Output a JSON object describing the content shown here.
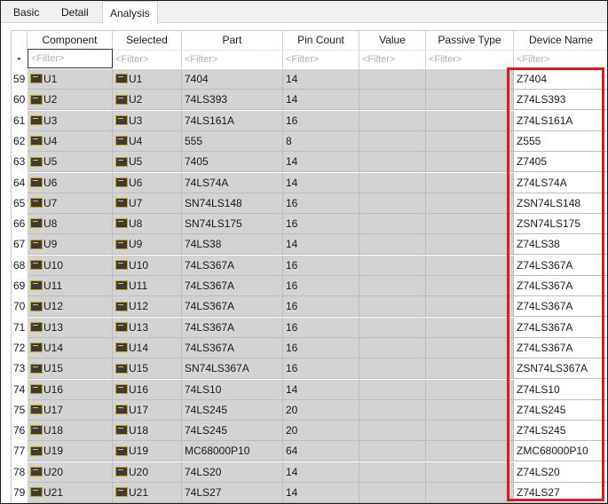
{
  "tabs": [
    "Basic",
    "Detail",
    "Analysis"
  ],
  "active_tab": "Analysis",
  "columns": [
    "Component",
    "Selected",
    "Part",
    "Pin Count",
    "Value",
    "Passive Type",
    "Device Name"
  ],
  "filter_placeholder": "<Filter>",
  "row_indicator": "▸",
  "rows": [
    {
      "num": "59",
      "component": "U1",
      "selected": "U1",
      "part": "7404",
      "pins": "14",
      "value": "",
      "passive": "",
      "device": "Z7404"
    },
    {
      "num": "60",
      "component": "U2",
      "selected": "U2",
      "part": "74LS393",
      "pins": "14",
      "value": "",
      "passive": "",
      "device": "Z74LS393"
    },
    {
      "num": "61",
      "component": "U3",
      "selected": "U3",
      "part": "74LS161A",
      "pins": "16",
      "value": "",
      "passive": "",
      "device": "Z74LS161A"
    },
    {
      "num": "62",
      "component": "U4",
      "selected": "U4",
      "part": "555",
      "pins": "8",
      "value": "",
      "passive": "",
      "device": "Z555"
    },
    {
      "num": "63",
      "component": "U5",
      "selected": "U5",
      "part": "7405",
      "pins": "14",
      "value": "",
      "passive": "",
      "device": "Z7405"
    },
    {
      "num": "64",
      "component": "U6",
      "selected": "U6",
      "part": "74LS74A",
      "pins": "14",
      "value": "",
      "passive": "",
      "device": "Z74LS74A"
    },
    {
      "num": "65",
      "component": "U7",
      "selected": "U7",
      "part": "SN74LS148",
      "pins": "16",
      "value": "",
      "passive": "",
      "device": "ZSN74LS148"
    },
    {
      "num": "66",
      "component": "U8",
      "selected": "U8",
      "part": "SN74LS175",
      "pins": "16",
      "value": "",
      "passive": "",
      "device": "ZSN74LS175"
    },
    {
      "num": "67",
      "component": "U9",
      "selected": "U9",
      "part": "74LS38",
      "pins": "14",
      "value": "",
      "passive": "",
      "device": "Z74LS38"
    },
    {
      "num": "68",
      "component": "U10",
      "selected": "U10",
      "part": "74LS367A",
      "pins": "16",
      "value": "",
      "passive": "",
      "device": "Z74LS367A"
    },
    {
      "num": "69",
      "component": "U11",
      "selected": "U11",
      "part": "74LS367A",
      "pins": "16",
      "value": "",
      "passive": "",
      "device": "Z74LS367A"
    },
    {
      "num": "70",
      "component": "U12",
      "selected": "U12",
      "part": "74LS367A",
      "pins": "16",
      "value": "",
      "passive": "",
      "device": "Z74LS367A"
    },
    {
      "num": "71",
      "component": "U13",
      "selected": "U13",
      "part": "74LS367A",
      "pins": "16",
      "value": "",
      "passive": "",
      "device": "Z74LS367A"
    },
    {
      "num": "72",
      "component": "U14",
      "selected": "U14",
      "part": "74LS367A",
      "pins": "16",
      "value": "",
      "passive": "",
      "device": "Z74LS367A"
    },
    {
      "num": "73",
      "component": "U15",
      "selected": "U15",
      "part": "SN74LS367A",
      "pins": "16",
      "value": "",
      "passive": "",
      "device": "ZSN74LS367A"
    },
    {
      "num": "74",
      "component": "U16",
      "selected": "U16",
      "part": "74LS10",
      "pins": "14",
      "value": "",
      "passive": "",
      "device": "Z74LS10"
    },
    {
      "num": "75",
      "component": "U17",
      "selected": "U17",
      "part": "74LS245",
      "pins": "20",
      "value": "",
      "passive": "",
      "device": "Z74LS245"
    },
    {
      "num": "76",
      "component": "U18",
      "selected": "U18",
      "part": "74LS245",
      "pins": "20",
      "value": "",
      "passive": "",
      "device": "Z74LS245"
    },
    {
      "num": "77",
      "component": "U19",
      "selected": "U19",
      "part": "MC68000P10",
      "pins": "64",
      "value": "",
      "passive": "",
      "device": "ZMC68000P10"
    },
    {
      "num": "78",
      "component": "U20",
      "selected": "U20",
      "part": "74LS20",
      "pins": "14",
      "value": "",
      "passive": "",
      "device": "Z74LS20"
    },
    {
      "num": "79",
      "component": "U21",
      "selected": "U21",
      "part": "74LS27",
      "pins": "14",
      "value": "",
      "passive": "",
      "device": "Z74LS27"
    }
  ],
  "colors": {
    "grey_cell": "#d3d3d3",
    "highlight": "#e01a1a"
  },
  "icons": {
    "component": "ic-chip-icon"
  }
}
